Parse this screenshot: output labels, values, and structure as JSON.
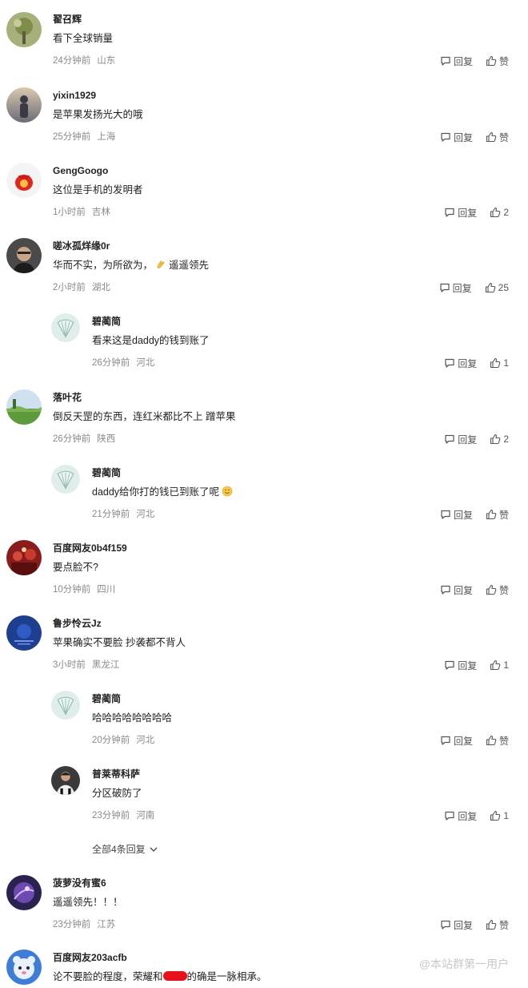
{
  "labels": {
    "reply": "回复",
    "like": "赞"
  },
  "comments": [
    {
      "user": "翟召辉",
      "text": "看下全球销量",
      "time": "24分钟前",
      "loc": "山东",
      "likes": "赞"
    },
    {
      "user": "yixin1929",
      "text": "是苹果发扬光大的哦",
      "time": "25分钟前",
      "loc": "上海",
      "likes": "赞"
    },
    {
      "user": "GengGoogo",
      "text": "这位是手机的发明者",
      "time": "1小时前",
      "loc": "吉林",
      "likes": "2"
    },
    {
      "user": "嗟冰孤烊缘0r",
      "text_a": "华而不实，为所欲为，",
      "text_b": "遥遥领先",
      "time": "2小时前",
      "loc": "湖北",
      "likes": "25"
    },
    {
      "user": "碧蔺简",
      "text": "看来这是daddy的钱到账了",
      "time": "26分钟前",
      "loc": "河北",
      "likes": "1"
    },
    {
      "user": "落叶花",
      "text": "倒反天罡的东西，连红米都比不上 蹭苹果",
      "time": "26分钟前",
      "loc": "陕西",
      "likes": "2"
    },
    {
      "user": "碧蔺简",
      "text": "daddy给你打的钱已到账了呢",
      "time": "21分钟前",
      "loc": "河北",
      "likes": "赞"
    },
    {
      "user": "百度网友0b4f159",
      "text": "要点脸不?",
      "time": "10分钟前",
      "loc": "四川",
      "likes": "赞"
    },
    {
      "user": "鲁步怜云Jz",
      "text": "苹果确实不要脸 抄袭都不背人",
      "time": "3小时前",
      "loc": "黑龙江",
      "likes": "1"
    },
    {
      "user": "碧蔺简",
      "text": "哈哈哈哈哈哈哈哈",
      "time": "20分钟前",
      "loc": "河北",
      "likes": "赞"
    },
    {
      "user": "普莱蒂科萨",
      "text": "分区破防了",
      "time": "23分钟前",
      "loc": "河南",
      "likes": "1"
    },
    {
      "user": "菠萝没有蜜6",
      "text": "遥遥领先！！！",
      "time": "23分钟前",
      "loc": "江苏",
      "likes": "赞"
    },
    {
      "user": "百度网友203acfb",
      "text_a": "论不要脸的程度，荣耀和",
      "text_b": "的确是一脉相承。"
    }
  ],
  "expand_replies": "全部4条回复",
  "watermark": "@本站群第一用户",
  "colors": {
    "text": "#222222",
    "meta": "#8a8a8a",
    "redaction": "#e8101a"
  }
}
